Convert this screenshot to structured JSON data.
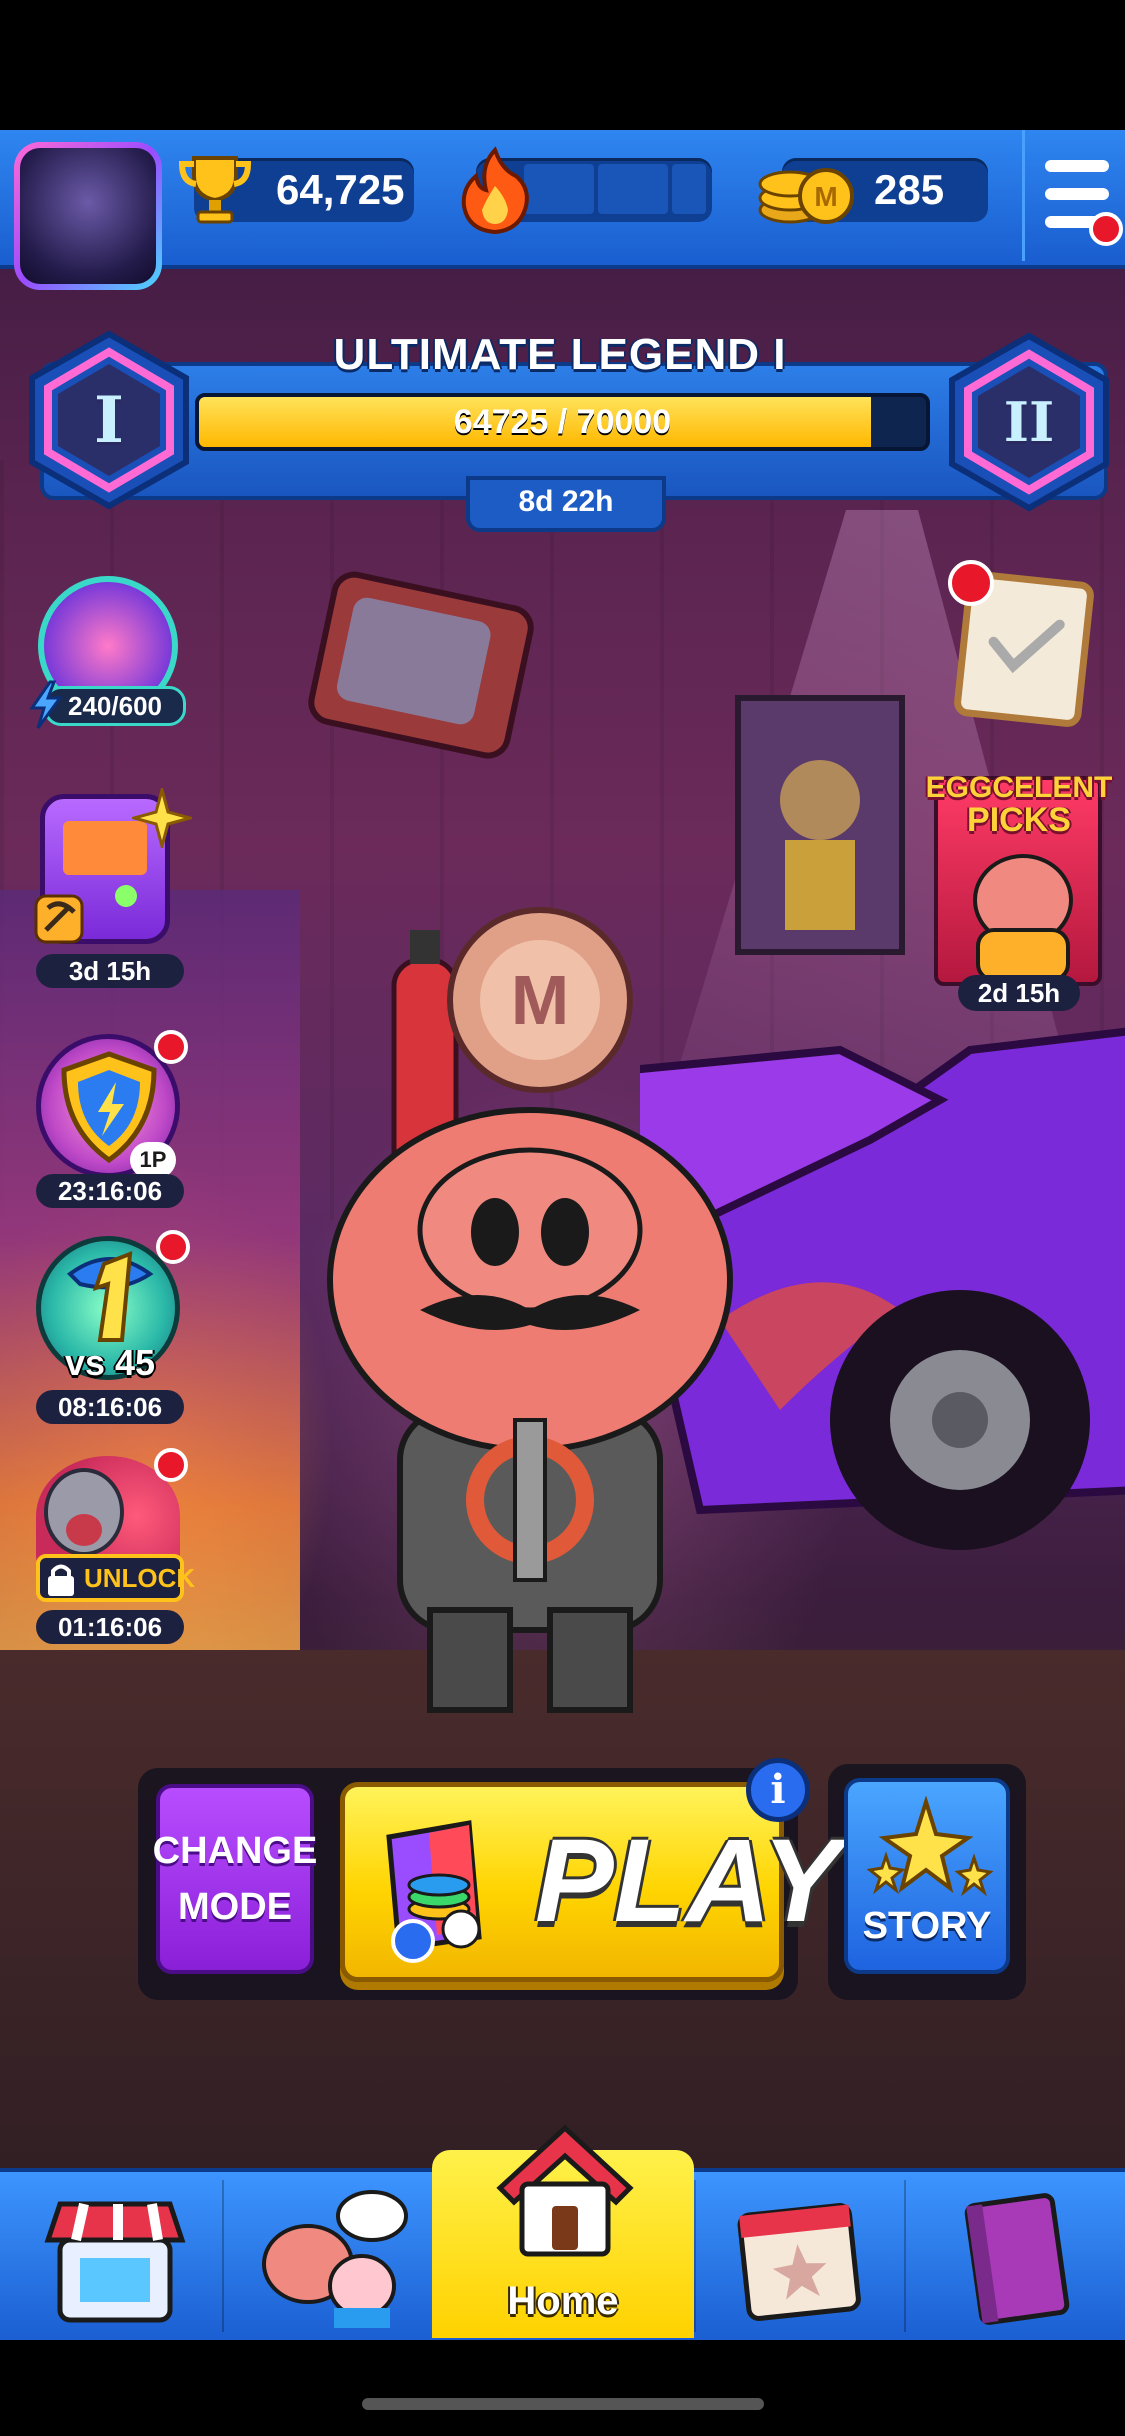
{
  "topbar": {
    "trophies": "64,725",
    "coins": "285",
    "streak_segments_filled": 0,
    "streak_segments_total": 3
  },
  "rank": {
    "title": "ULTIMATE LEGEND I",
    "progress_text": "64725 / 70000",
    "progress_fraction": 0.925,
    "current_tier": "I",
    "next_tier": "II",
    "time_left": "8d 22h"
  },
  "left_items": {
    "energy": "240/600",
    "event_timer": "3d 15h",
    "pass_timer": "23:16:06",
    "pass_badge": "1P",
    "vs_label": "vs 45",
    "vs_timer": "08:16:06",
    "unlock_label": "UNLOCK",
    "unlock_timer": "01:16:06"
  },
  "right_items": {
    "picks_title_line1": "EGGCELENT",
    "picks_title_line2": "PICKS",
    "picks_timer": "2d 15h"
  },
  "actions": {
    "change_mode_line1": "CHANGE",
    "change_mode_line2": "MODE",
    "play": "PLAY",
    "info": "i",
    "story": "STORY"
  },
  "nav": {
    "home": "Home"
  },
  "colors": {
    "topbar": "#2f86f0",
    "play": "#ffd400",
    "change_mode": "#9a2ee8",
    "story": "#2b7cf0",
    "notification": "#e8172a"
  }
}
